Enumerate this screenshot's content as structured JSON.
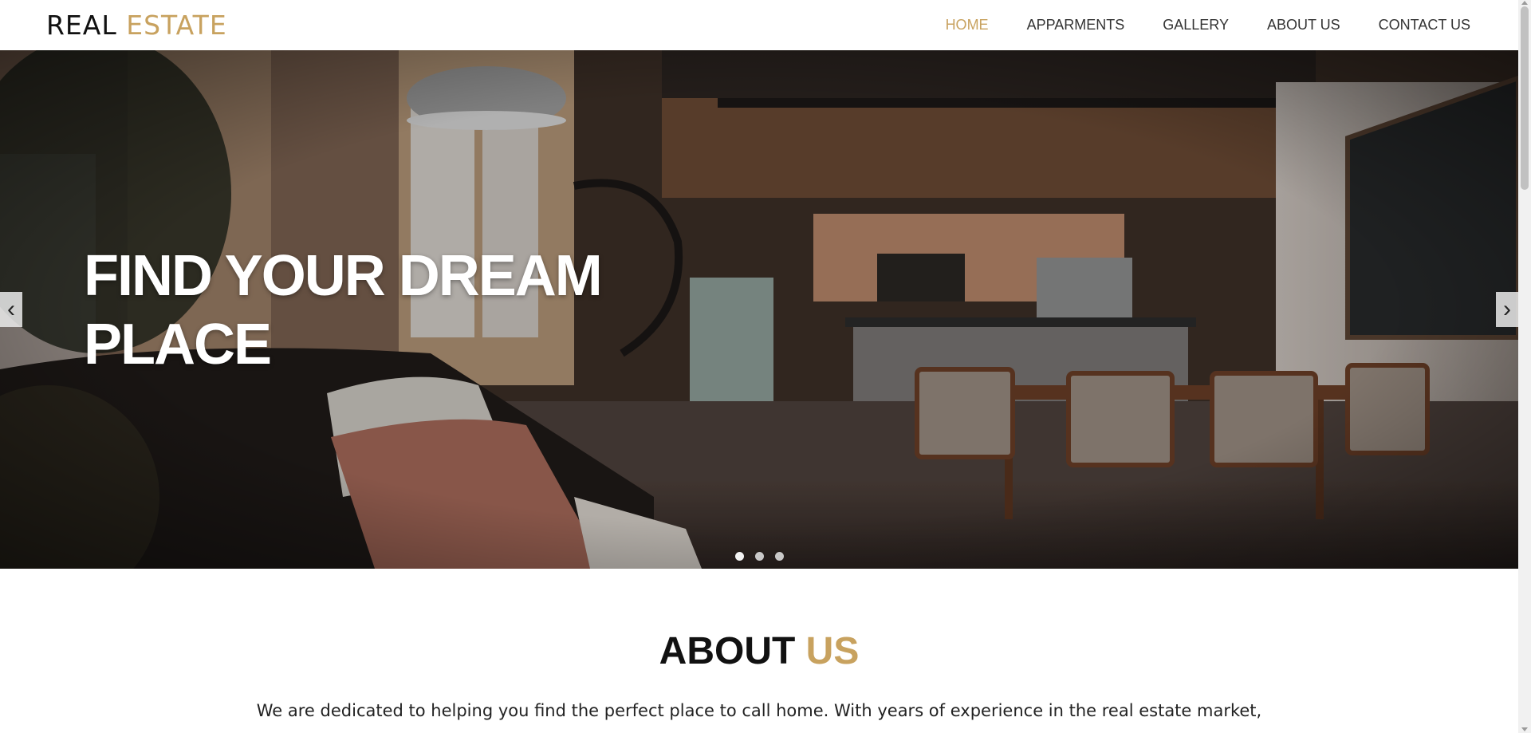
{
  "header": {
    "logo_primary": "REAL",
    "logo_accent": "ESTATE",
    "nav": [
      {
        "label": "HOME",
        "active": true
      },
      {
        "label": "APPARMENTS",
        "active": false
      },
      {
        "label": "GALLERY",
        "active": false
      },
      {
        "label": "ABOUT US",
        "active": false
      },
      {
        "label": "CONTACT US",
        "active": false
      }
    ]
  },
  "hero": {
    "title_line1": "FIND YOUR DREAM",
    "title_line2": "PLACE",
    "prev_icon": "‹",
    "next_icon": "›",
    "slides_count": 3,
    "active_slide": 1
  },
  "about": {
    "title_primary": "ABOUT",
    "title_accent": "US",
    "text": "We are dedicated to helping you find the perfect place to call home. With years of experience in the real estate market,"
  },
  "colors": {
    "accent": "#c8a25f",
    "text": "#111111"
  }
}
